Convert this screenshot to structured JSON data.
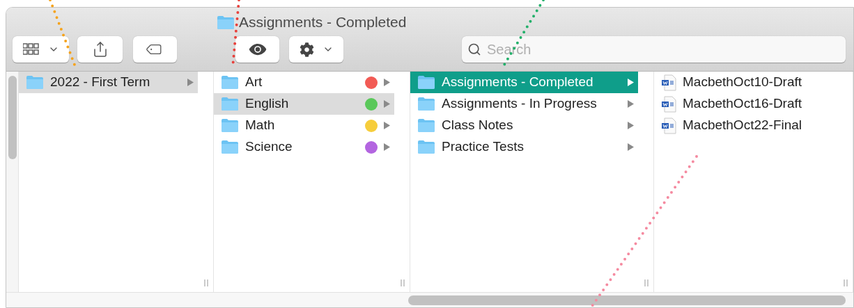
{
  "window": {
    "title": "Assignments - Completed"
  },
  "search": {
    "placeholder": "Search"
  },
  "columns": [
    {
      "focused": false,
      "items": [
        {
          "kind": "folder",
          "name": "2022 - First Term",
          "selected": true
        }
      ]
    },
    {
      "focused": false,
      "items": [
        {
          "kind": "folder",
          "name": "Art",
          "selected": false,
          "color": "#f25b55"
        },
        {
          "kind": "folder",
          "name": "English",
          "selected": true,
          "color": "#5ac85a"
        },
        {
          "kind": "folder",
          "name": "Math",
          "selected": false,
          "color": "#f6cd3c"
        },
        {
          "kind": "folder",
          "name": "Science",
          "selected": false,
          "color": "#b365e0"
        }
      ]
    },
    {
      "focused": true,
      "items": [
        {
          "kind": "folder",
          "name": "Assignments - Completed",
          "selected": true
        },
        {
          "kind": "folder",
          "name": "Assignments - In Progress",
          "selected": false
        },
        {
          "kind": "folder",
          "name": "Class Notes",
          "selected": false
        },
        {
          "kind": "folder",
          "name": "Practice Tests",
          "selected": false
        }
      ]
    },
    {
      "items": [
        {
          "kind": "document",
          "name": "MacbethOct10-Draft",
          "selected": false
        },
        {
          "kind": "document",
          "name": "MacbethOct16-Draft",
          "selected": false
        },
        {
          "kind": "document",
          "name": "MacbethOct22-Final",
          "selected": false
        }
      ]
    }
  ],
  "annotations": [
    {
      "color": "#f5a31c"
    },
    {
      "color": "#e8413c"
    },
    {
      "color": "#22b06a"
    },
    {
      "color": "#f58aa0"
    }
  ]
}
